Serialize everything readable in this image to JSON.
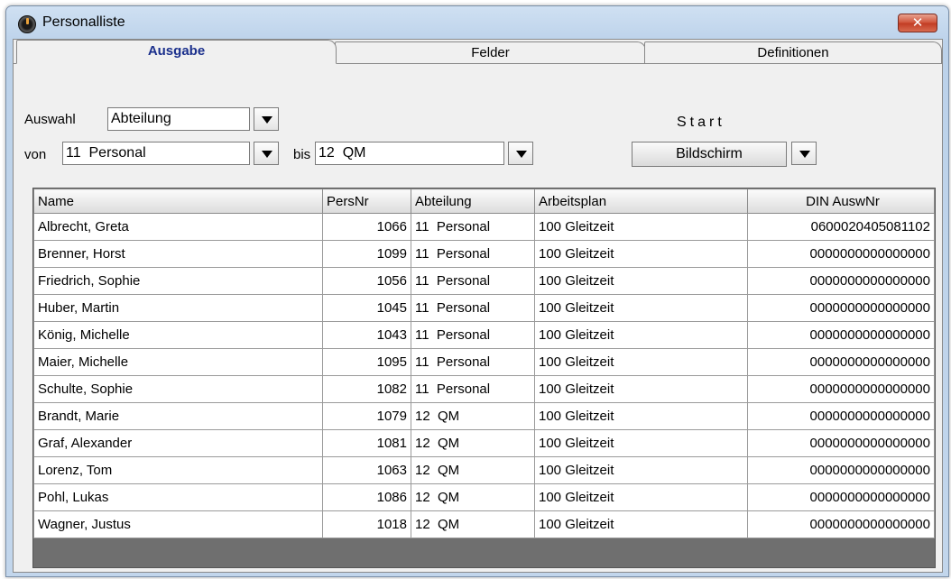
{
  "window": {
    "title": "Personalliste",
    "close_label": "✕"
  },
  "tabs": [
    {
      "label": "Ausgabe",
      "active": true
    },
    {
      "label": "Felder",
      "active": false
    },
    {
      "label": "Definitionen",
      "active": false
    }
  ],
  "selection": {
    "auswahl_label": "Auswahl",
    "auswahl_value": "Abteilung",
    "von_label": "von",
    "von_value": "11  Personal",
    "bis_label": "bis",
    "bis_value": "12  QM"
  },
  "start": {
    "label": "Start",
    "button_label": "Bildschirm"
  },
  "table": {
    "columns": [
      "Name",
      "PersNr",
      "Abteilung",
      "Arbeitsplan",
      "DIN AuswNr"
    ],
    "rows": [
      [
        "Albrecht, Greta",
        "1066",
        "11  Personal",
        "100 Gleitzeit",
        "0600020405081102"
      ],
      [
        "Brenner, Horst",
        "1099",
        "11  Personal",
        "100 Gleitzeit",
        "0000000000000000"
      ],
      [
        "Friedrich, Sophie",
        "1056",
        "11  Personal",
        "100 Gleitzeit",
        "0000000000000000"
      ],
      [
        "Huber, Martin",
        "1045",
        "11  Personal",
        "100 Gleitzeit",
        "0000000000000000"
      ],
      [
        "König, Michelle",
        "1043",
        "11  Personal",
        "100 Gleitzeit",
        "0000000000000000"
      ],
      [
        "Maier, Michelle",
        "1095",
        "11  Personal",
        "100 Gleitzeit",
        "0000000000000000"
      ],
      [
        "Schulte, Sophie",
        "1082",
        "11  Personal",
        "100 Gleitzeit",
        "0000000000000000"
      ],
      [
        "Brandt, Marie",
        "1079",
        "12  QM",
        "100 Gleitzeit",
        "0000000000000000"
      ],
      [
        "Graf, Alexander",
        "1081",
        "12  QM",
        "100 Gleitzeit",
        "0000000000000000"
      ],
      [
        "Lorenz, Tom",
        "1063",
        "12  QM",
        "100 Gleitzeit",
        "0000000000000000"
      ],
      [
        "Pohl, Lukas",
        "1086",
        "12  QM",
        "100 Gleitzeit",
        "0000000000000000"
      ],
      [
        "Wagner, Justus",
        "1018",
        "12  QM",
        "100 Gleitzeit",
        "0000000000000000"
      ]
    ]
  }
}
